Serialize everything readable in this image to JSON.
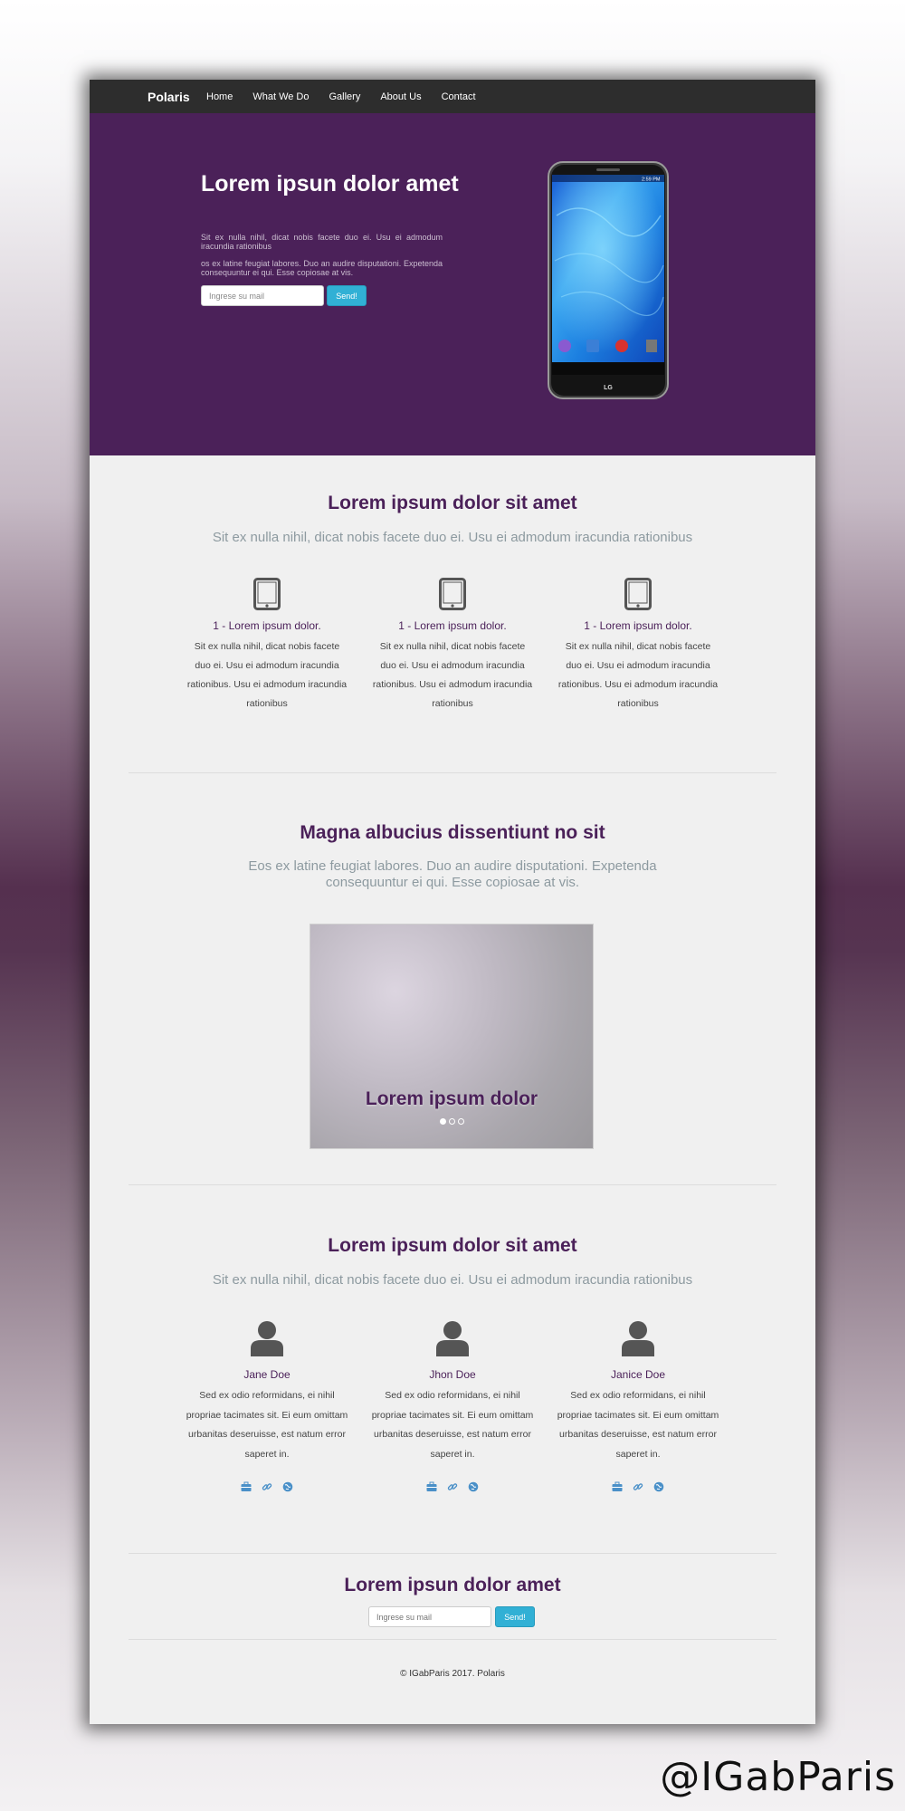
{
  "nav": {
    "brand": "Polaris",
    "links": [
      "Home",
      "What We Do",
      "Gallery",
      "About Us",
      "Contact"
    ]
  },
  "hero": {
    "title": "Lorem ipsun dolor amet",
    "paragraph1": "Sit ex nulla nihil, dicat nobis facete duo ei. Usu ei admodum iracundia rationibus",
    "paragraph2": "os ex latine feugiat labores. Duo an audire disputationi. Expetenda consequuntur ei qui. Esse copiosae at vis.",
    "email_placeholder": "Ingrese su mail",
    "send_label": "Send!",
    "phone_time": "2:59 PM",
    "phone_brand": "LG"
  },
  "features_section": {
    "title": "Lorem ipsum dolor sit amet",
    "subtitle": "Sit ex nulla nihil, dicat nobis facete duo ei. Usu ei admodum iracundia rationibus",
    "items": [
      {
        "icon": "tablet-icon",
        "title": "1 - Lorem ipsum dolor.",
        "text": "Sit ex nulla nihil, dicat nobis facete duo ei. Usu ei admodum iracundia rationibus. Usu ei admodum iracundia rationibus"
      },
      {
        "icon": "tablet-icon",
        "title": "1 - Lorem ipsum dolor.",
        "text": "Sit ex nulla nihil, dicat nobis facete duo ei. Usu ei admodum iracundia rationibus. Usu ei admodum iracundia rationibus"
      },
      {
        "icon": "tablet-icon",
        "title": "1 - Lorem ipsum dolor.",
        "text": "Sit ex nulla nihil, dicat nobis facete duo ei. Usu ei admodum iracundia rationibus. Usu ei admodum iracundia rationibus"
      }
    ]
  },
  "gallery_section": {
    "title": "Magna albucius dissentiunt no sit",
    "subtitle": "Eos ex latine feugiat labores. Duo an audire disputationi. Expetenda consequuntur ei qui. Esse copiosae at vis.",
    "carousel_caption": "Lorem ipsum dolor",
    "slide_count": 3,
    "active_slide": 1
  },
  "team_section": {
    "title": "Lorem ipsum dolor sit amet",
    "subtitle": "Sit ex nulla nihil, dicat nobis facete duo ei. Usu ei admodum iracundia rationibus",
    "members": [
      {
        "name": "Jane Doe",
        "bio": "Sed ex odio reformidans, ei nihil propriae tacimates sit. Ei eum omittam urbanitas deseruisse, est natum error saperet in."
      },
      {
        "name": "Jhon Doe",
        "bio": "Sed ex odio reformidans, ei nihil propriae tacimates sit. Ei eum omittam urbanitas deseruisse, est natum error saperet in."
      },
      {
        "name": "Janice Doe",
        "bio": "Sed ex odio reformidans, ei nihil propriae tacimates sit. Ei eum omittam urbanitas deseruisse, est natum error saperet in."
      }
    ],
    "social_icons": [
      "briefcase-icon",
      "link-icon",
      "globe-icon"
    ]
  },
  "newsletter": {
    "title": "Lorem ipsun dolor amet",
    "email_placeholder": "Ingrese su mail",
    "send_label": "Send!"
  },
  "footer": {
    "text": "© IGabParis 2017. Polaris"
  },
  "watermark": "@IGabParis",
  "colors": {
    "accent_purple": "#4b2159",
    "nav_bg": "#2d2d2d",
    "button_blue": "#31b0d5",
    "subtitle_gray": "#8d9aa0",
    "page_bg": "#f0f0f0",
    "social_blue": "#4a90c8"
  }
}
